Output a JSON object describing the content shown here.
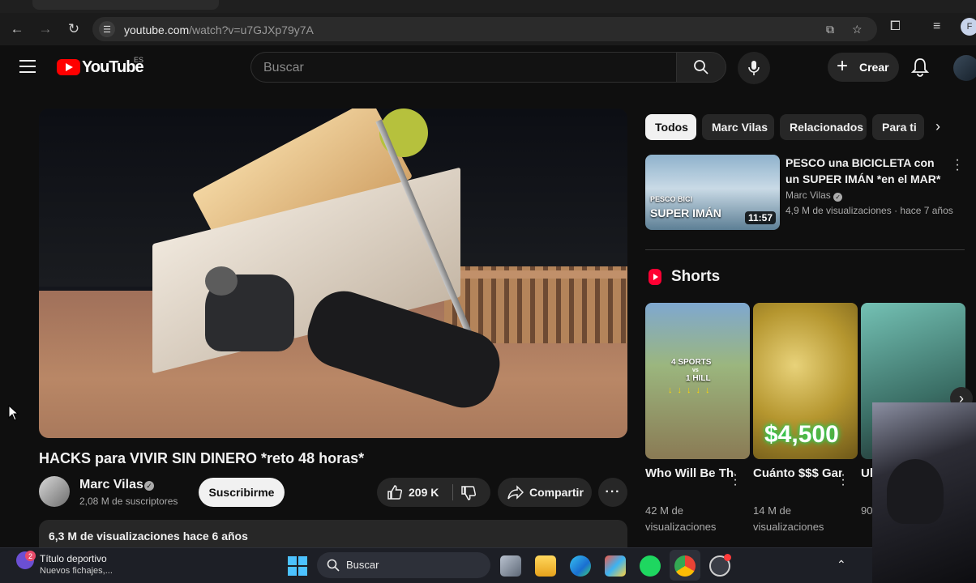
{
  "browser": {
    "url_domain": "youtube.com",
    "url_path": "/watch?v=u7GJXp79y7A",
    "profile_initial": "F"
  },
  "header": {
    "logo_text": "YouTube",
    "region": "ES",
    "search_placeholder": "Buscar",
    "create_label": "Crear"
  },
  "video": {
    "title": "HACKS para VIVIR SIN DINERO *reto 48 horas*",
    "channel": "Marc Vilas",
    "subscribers": "2,08 M de suscriptores",
    "subscribe_label": "Suscribirme",
    "likes": "209 K",
    "share_label": "Compartir",
    "views_date": "6,3 M de visualizaciones  hace 6 años"
  },
  "sidebar": {
    "chips": [
      "Todos",
      "Marc Vilas",
      "Relacionados",
      "Para ti"
    ],
    "recommended": {
      "title": "PESCO una BICICLETA con un SUPER IMÁN *en el MAR*",
      "channel": "Marc Vilas",
      "meta": "4,9 M de visualizaciones · hace 7 años",
      "duration": "11:57",
      "thumb_line1": "PESCO BICI",
      "thumb_line2": "SUPER IMÁN"
    },
    "shorts_heading": "Shorts",
    "shorts": [
      {
        "title": "Who Will Be The ...",
        "views": "42 M de visualizaciones",
        "overlay1": "4 SPORTS",
        "overlay2": "vs",
        "overlay3": "1 HILL"
      },
      {
        "title": "Cuánto $$$ Ganó en Un...",
        "views": "14 M de visualizaciones",
        "overlay1": "$4,500"
      },
      {
        "title": "Ul Go",
        "views": "90"
      }
    ]
  },
  "taskbar": {
    "widget_title": "Título deportivo",
    "widget_subtitle": "Nuevos fichajes,...",
    "widget_badge": "2",
    "search_label": "Buscar"
  }
}
